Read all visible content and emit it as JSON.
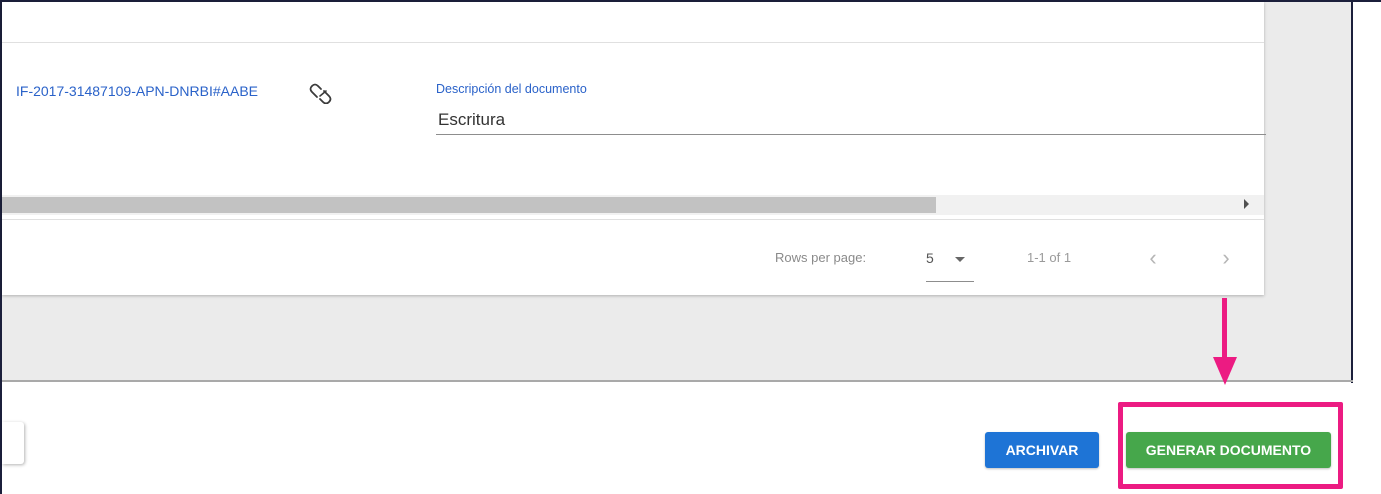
{
  "document": {
    "link_text": "IF-2017-31487109-APN-DNRBI#AABE",
    "unlink_icon": "unlink-icon",
    "description_label": "Descripción del documento",
    "description_value": "Escritura"
  },
  "pagination": {
    "rows_per_page_label": "Rows per page:",
    "rows_per_page_value": "5",
    "range_text": "1-1 of 1",
    "prev_icon": "chevron-left-icon",
    "next_icon": "chevron-right-icon",
    "prev_glyph": "‹",
    "next_glyph": "›"
  },
  "actions": {
    "archivar_label": "ARCHIVAR",
    "generar_label": "GENERAR DOCUMENTO"
  },
  "annotation": {
    "highlight_color": "#ec1b82"
  },
  "colors": {
    "link_blue": "#2a62c9",
    "primary_blue": "#1e74d6",
    "success_green": "#46a74b",
    "panel_gray": "#ebebeb"
  }
}
